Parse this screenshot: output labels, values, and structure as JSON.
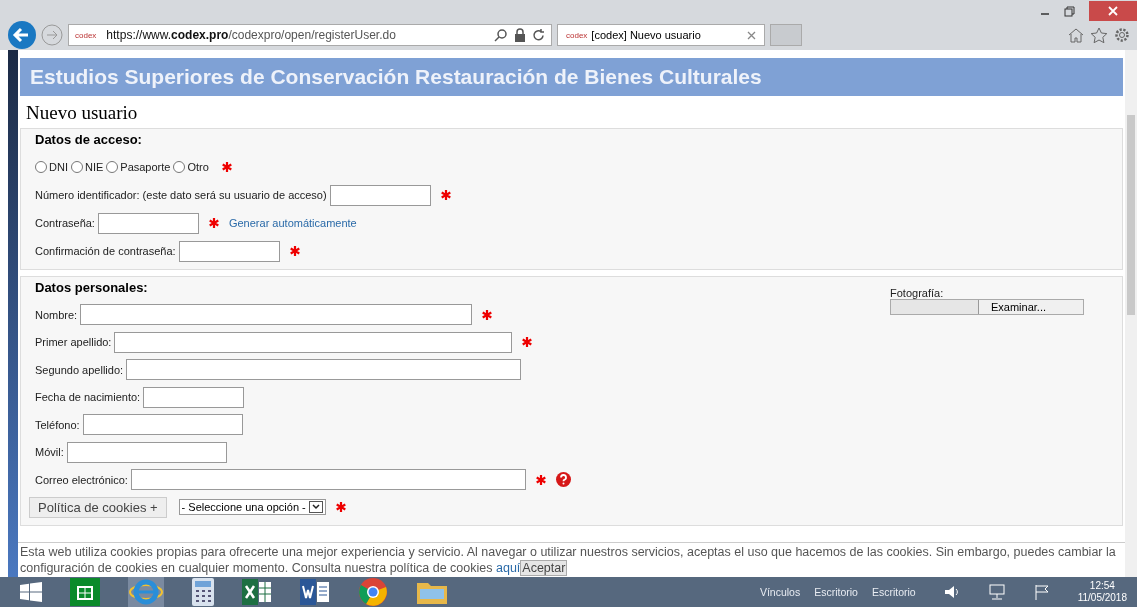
{
  "browser": {
    "url_host": "https://www.",
    "url_domain": "codex.pro",
    "url_path": "/codexpro/open/registerUser.do",
    "favicon": "codex",
    "tab_title": "[codex] Nuevo usuario",
    "tab_favicon": "codex"
  },
  "header": {
    "title": "Estudios Superiores de Conservación Restauración de Bienes Culturales"
  },
  "page_title": "Nuevo usuario",
  "access": {
    "legend": "Datos de acceso:",
    "id_types": [
      {
        "label": "DNI",
        "selected": false
      },
      {
        "label": "NIE",
        "selected": false
      },
      {
        "label": "Pasaporte",
        "selected": false
      },
      {
        "label": "Otro",
        "selected": false
      }
    ],
    "id_required": true,
    "fields": [
      {
        "label": "Número identificador: (este dato será su usuario de acceso)",
        "required": true
      },
      {
        "label": "Contraseña:",
        "required": true,
        "link": "Generar automáticamente"
      },
      {
        "label": "Confirmación de contraseña:",
        "required": true
      }
    ]
  },
  "personal": {
    "legend": "Datos personales:",
    "fields": [
      {
        "kind": "text",
        "label": "Nombre:",
        "required": true
      },
      {
        "kind": "text",
        "label": "Primer apellido:",
        "required": true
      },
      {
        "kind": "text",
        "label": "Segundo apellido:",
        "required": false
      },
      {
        "kind": "text",
        "label": "Fecha de nacimiento:",
        "required": false
      },
      {
        "kind": "text",
        "label": "Teléfono:",
        "required": false
      },
      {
        "kind": "text",
        "label": "Móvil:",
        "required": false
      },
      {
        "kind": "text",
        "label": "Correo electrónico:",
        "required": true,
        "help": true
      },
      {
        "kind": "select",
        "value": "- Seleccione una opción -",
        "required": true
      }
    ],
    "photo": {
      "label": "Fotografía:",
      "button": "Examinar..."
    }
  },
  "cookies": {
    "tab": "Política de cookies +",
    "message": "Esta web utiliza cookies propias para ofrecerte una mejor experiencia y servicio. Al navegar o utilizar nuestros servicios, aceptas el uso que hacemos de las cookies. Sin embargo, puedes cambiar la configuración de cookies en cualquier momento. Consulta nuestra política de cookies",
    "link": "aquí",
    "button": "Aceptar"
  },
  "taskbar": {
    "links": [
      "Vínculos",
      "Escritorio",
      "Escritorio"
    ],
    "time": "12:54",
    "date": "11/05/2018"
  }
}
